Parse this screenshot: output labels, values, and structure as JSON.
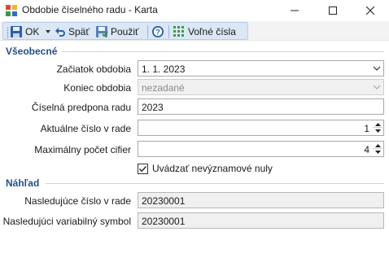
{
  "window": {
    "title": "Obdobie číselného radu - Karta",
    "icon": "app-icon",
    "controls": [
      "minimize-icon",
      "maximize-icon",
      "close-icon"
    ]
  },
  "toolbar": {
    "ok_label": "OK",
    "back_label": "Späť",
    "apply_label": "Použiť",
    "free_numbers_label": "Voľné čísla"
  },
  "sections": {
    "general": "Všeobecné",
    "preview": "Náhľad"
  },
  "form": {
    "start_label": "Začiatok obdobia",
    "start_value": "1. 1. 2023",
    "end_label": "Koniec obdobia",
    "end_value": "nezadané",
    "prefix_label": "Číselná predpona radu",
    "prefix_value": "2023",
    "current_label": "Aktuálne číslo v rade",
    "current_value": "1",
    "digits_label": "Maximálny počet cifier",
    "digits_value": "4",
    "leading_zeros_label": "Uvádzať nevýznamové nuly",
    "leading_zeros_checked": true
  },
  "preview": {
    "next_label": "Nasledujúce číslo v rade",
    "next_value": "20230001",
    "varsym_label": "Nasledujúci variabilný symbol",
    "varsym_value": "20230001"
  },
  "colors": {
    "section_title": "#1f4e8c",
    "toolbar_strip": "#dbe7f5",
    "disabled_bg": "#f0f0f0"
  }
}
